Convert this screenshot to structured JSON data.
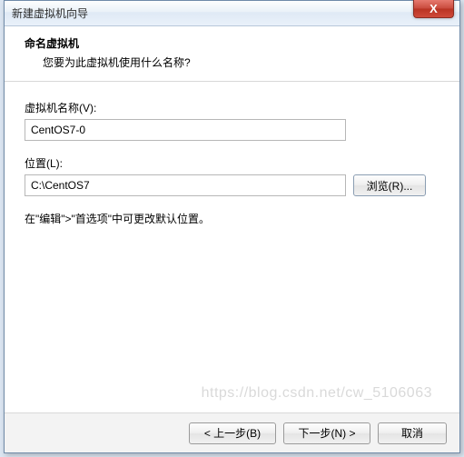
{
  "titlebar": {
    "text": "新建虚拟机向导",
    "close": "X"
  },
  "header": {
    "title": "命名虚拟机",
    "subtitle": "您要为此虚拟机使用什么名称?"
  },
  "fields": {
    "name_label": "虚拟机名称(V):",
    "name_value": "CentOS7-0",
    "location_label": "位置(L):",
    "location_value": "C:\\CentOS7",
    "browse_label": "浏览(R)..."
  },
  "hint": "在\"编辑\">\"首选项\"中可更改默认位置。",
  "footer": {
    "back": "< 上一步(B)",
    "next": "下一步(N) >",
    "cancel": "取消"
  },
  "watermark": "https://blog.csdn.net/cw_5106063"
}
